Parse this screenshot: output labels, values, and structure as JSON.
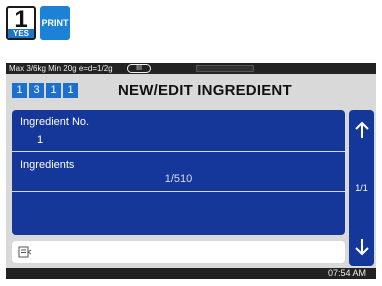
{
  "keys": {
    "one": {
      "number": "1",
      "sub": "YES"
    },
    "print": {
      "label": "PRINT"
    }
  },
  "statusbar": {
    "info": "Max 3/6kg Min 20g e=d=1/2g",
    "range": "III"
  },
  "titlebar": {
    "menu_path": [
      "1",
      "3",
      "1",
      "1"
    ],
    "title": "NEW/EDIT INGREDIENT"
  },
  "form": {
    "ingredient_no": {
      "label": "Ingredient No.",
      "value": "1"
    },
    "ingredients": {
      "label": "Ingredients",
      "value": "1/510"
    }
  },
  "pager": {
    "page": "1/1"
  },
  "footer": {
    "time": "07:54 AM"
  },
  "colors": {
    "accent": "#1c75c8",
    "panel": "#16379a",
    "screen_bg": "#d9d9d9",
    "bar_bg": "#222222"
  },
  "icons": {
    "up": "arrow-up-icon",
    "down": "arrow-down-icon",
    "input": "keyboard-input-icon"
  }
}
